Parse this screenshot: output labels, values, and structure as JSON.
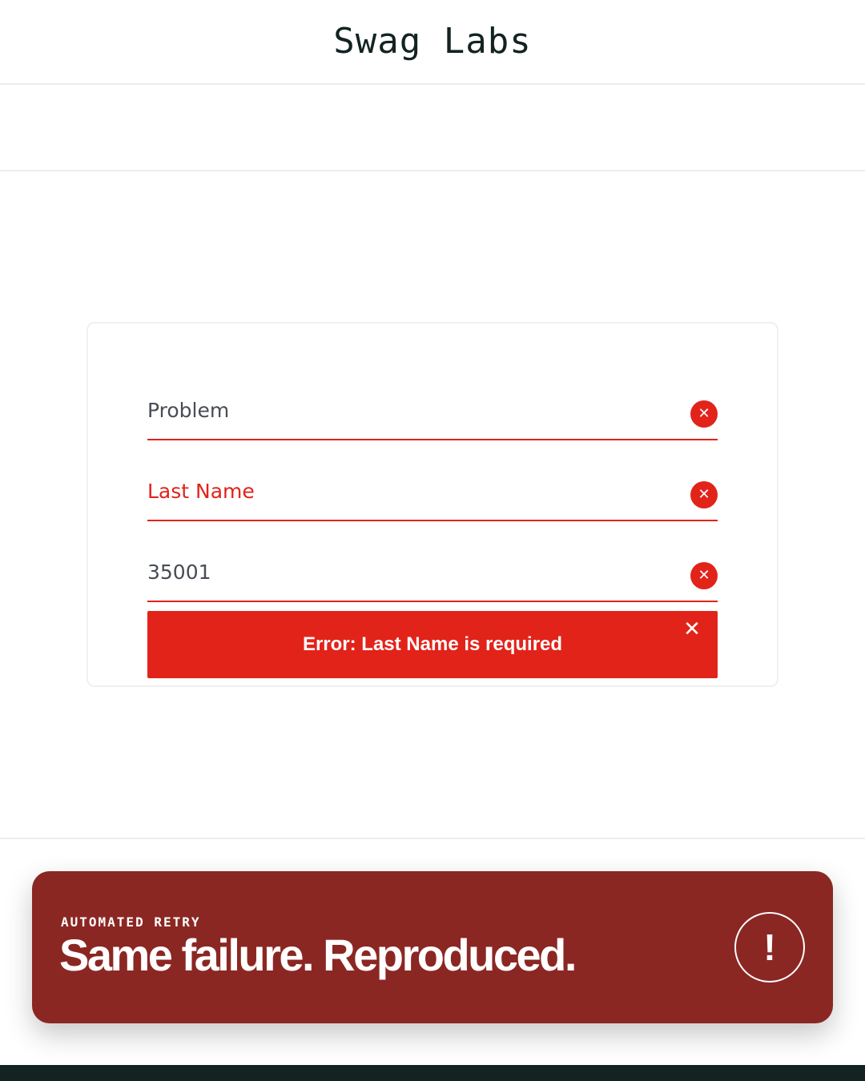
{
  "header": {
    "title": "Swag Labs"
  },
  "form": {
    "fields": [
      {
        "value": "Problem",
        "placeholder": "",
        "error_icon": "x-circle-icon"
      },
      {
        "value": "",
        "placeholder": "Last Name",
        "error_icon": "x-circle-icon"
      },
      {
        "value": "35001",
        "placeholder": "",
        "error_icon": "x-circle-icon"
      }
    ],
    "error_message": "Error: Last Name is required",
    "error_close_icon": "close-icon"
  },
  "toast": {
    "label": "AUTOMATED RETRY",
    "title": "Same failure. Reproduced.",
    "icon": "exclamation-icon"
  },
  "colors": {
    "error_red": "#e2231a",
    "toast_bg": "#8b2723",
    "text_dark": "#132322",
    "bottom_bar": "#132322"
  }
}
